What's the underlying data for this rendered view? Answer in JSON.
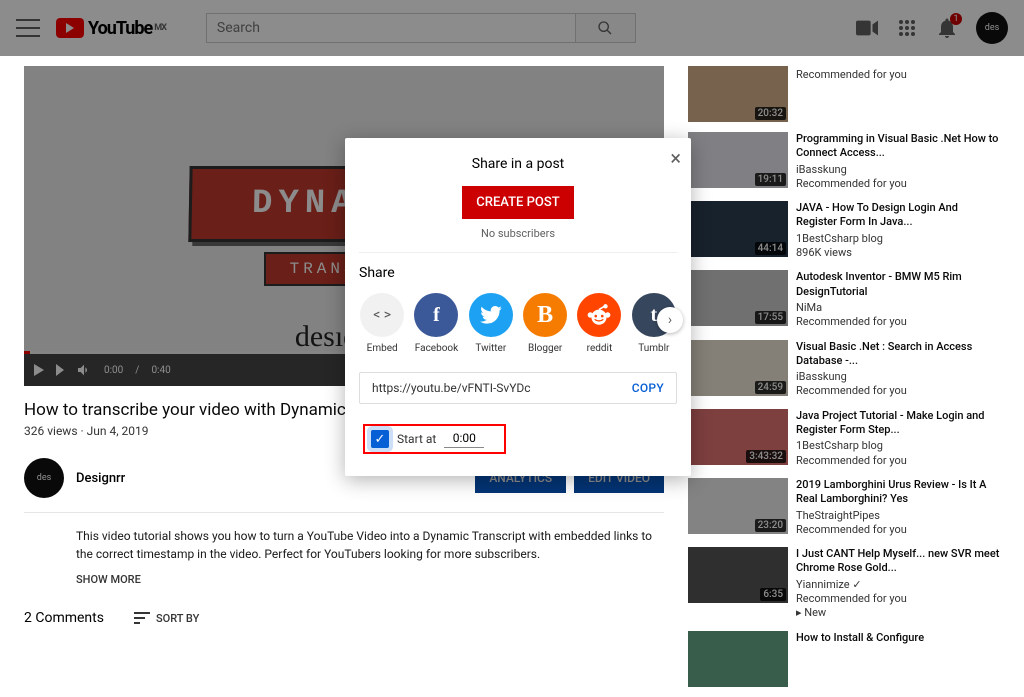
{
  "header": {
    "logo_text": "YouTube",
    "logo_region": "MX",
    "search_placeholder": "Search",
    "notif_count": "1"
  },
  "video": {
    "ribbon_main": "DYNAMIC",
    "ribbon_sub": "TRANSCRI",
    "brand": "desıɡnrr",
    "time_current": "0:00",
    "time_total": "0:40",
    "title": "How to transcribe your video with Dynamic Transcripts from",
    "views": "326 views",
    "date": "Jun 4, 2019",
    "channel": "Designrr",
    "analytics_btn": "ANALYTICS",
    "edit_btn": "EDIT VIDEO",
    "description": "This video tutorial shows you how to turn a YouTube Video into a Dynamic Transcript with embedded links to the correct timestamp in the video.  Perfect for YouTubers looking for more subscribers.",
    "show_more": "SHOW MORE",
    "comments_label": "2 Comments",
    "sort_label": "SORT BY"
  },
  "modal": {
    "title": "Share in a post",
    "create_btn": "CREATE POST",
    "no_subs": "No subscribers",
    "share_label": "Share",
    "targets": {
      "embed": "Embed",
      "facebook": "Facebook",
      "twitter": "Twitter",
      "blogger": "Blogger",
      "reddit": "reddit",
      "tumblr": "Tumblr"
    },
    "url": "https://youtu.be/vFNTI-SvYDc",
    "copy": "COPY",
    "start_at_label": "Start at",
    "start_at_time": "0:00",
    "start_at_checked": true
  },
  "recommendations": [
    {
      "title": "",
      "channel": "",
      "sub": "Recommended for you",
      "duration": "20:32"
    },
    {
      "title": "Programming in Visual Basic .Net How to Connect Access...",
      "channel": "iBasskung",
      "sub": "Recommended for you",
      "duration": "19:11"
    },
    {
      "title": "JAVA - How To Design Login And Register Form In Java...",
      "channel": "1BestCsharp blog",
      "sub": "896K views",
      "duration": "44:14"
    },
    {
      "title": "Autodesk Inventor - BMW M5 Rim DesignTutorial",
      "channel": "NiMa",
      "sub": "Recommended for you",
      "duration": "17:55"
    },
    {
      "title": "Visual Basic .Net : Search in Access Database -...",
      "channel": "iBasskung",
      "sub": "Recommended for you",
      "duration": "24:59"
    },
    {
      "title": "Java Project Tutorial - Make Login and Register Form Step...",
      "channel": "1BestCsharp blog",
      "sub": "Recommended for you",
      "duration": "3:43:32"
    },
    {
      "title": "2019 Lamborghini Urus Review - Is It A Real Lamborghini? Yes",
      "channel": "TheStraightPipes",
      "sub": "Recommended for you",
      "duration": "23:20"
    },
    {
      "title": "I Just CANT Help Myself... new SVR meet Chrome Rose Gold...",
      "channel": "Yiannimize ✓",
      "sub": "Recommended for you\n▸ New",
      "duration": "6:35"
    },
    {
      "title": "How to Install & Configure",
      "channel": "",
      "sub": "",
      "duration": ""
    }
  ]
}
